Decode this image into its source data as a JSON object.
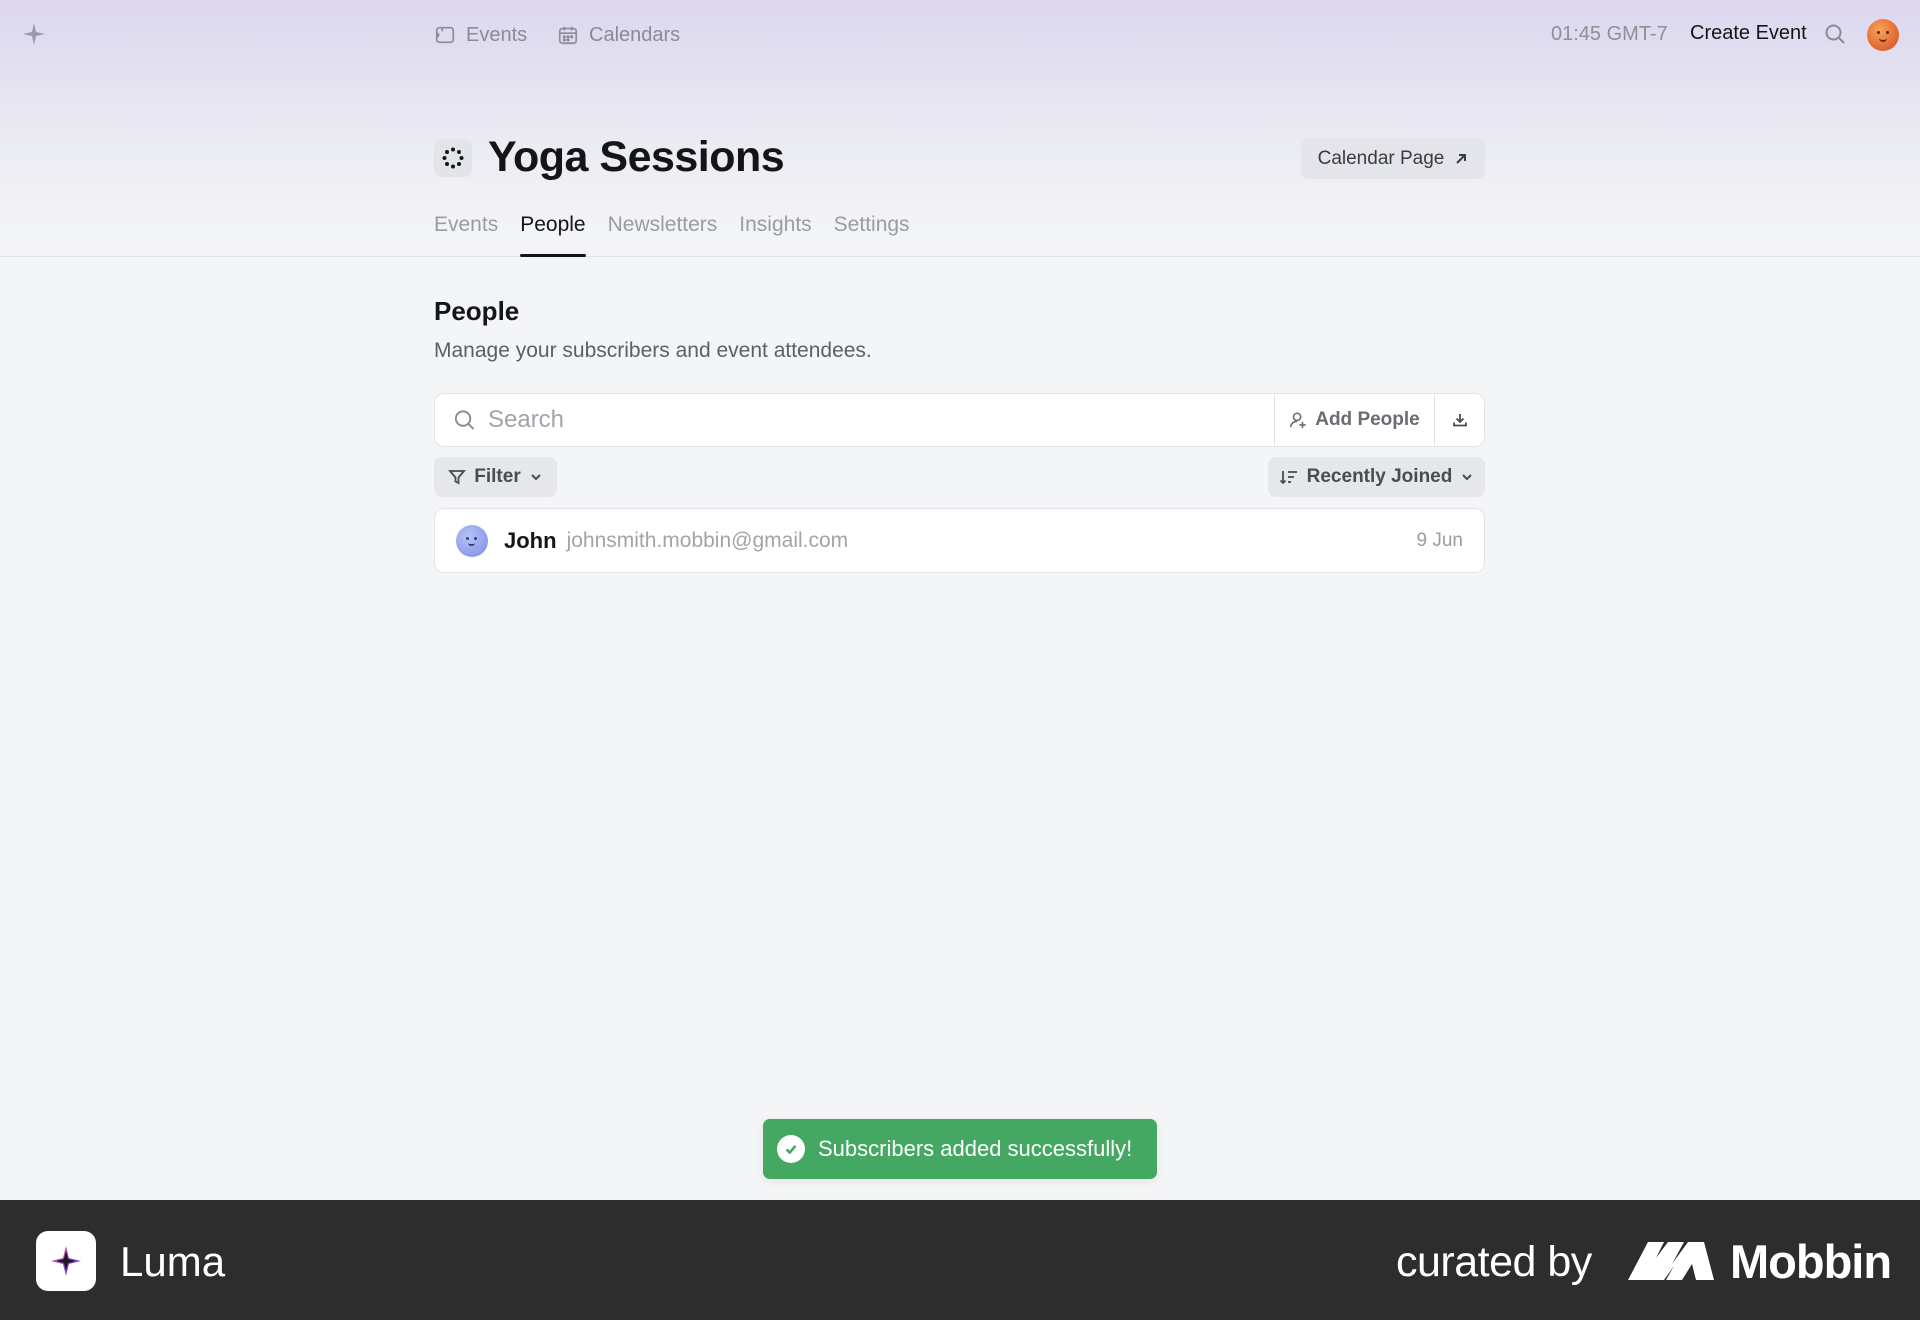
{
  "topnav": {
    "links": [
      {
        "label": "Events",
        "icon": "ticket-icon"
      },
      {
        "label": "Calendars",
        "icon": "calendar-icon"
      }
    ],
    "time": "01:45 GMT-7",
    "create_event": "Create Event"
  },
  "header": {
    "title": "Yoga Sessions",
    "calendar_page_button": "Calendar Page",
    "tabs": [
      {
        "label": "Events",
        "active": false
      },
      {
        "label": "People",
        "active": true
      },
      {
        "label": "Newsletters",
        "active": false
      },
      {
        "label": "Insights",
        "active": false
      },
      {
        "label": "Settings",
        "active": false
      }
    ]
  },
  "people": {
    "title": "People",
    "subtitle": "Manage your subscribers and event attendees.",
    "search_placeholder": "Search",
    "add_people": "Add People",
    "filter": "Filter",
    "sort": "Recently Joined",
    "rows": [
      {
        "name": "John",
        "email": "johnsmith.mobbin@gmail.com",
        "date": "9 Jun"
      }
    ]
  },
  "toast": {
    "message": "Subscribers added successfully!",
    "color": "#45a862"
  },
  "footer": {
    "app_name": "Luma",
    "curated_by": "curated by",
    "brand": "Mobbin"
  },
  "colors": {
    "accent_text": "#131517",
    "footer_bg": "#2d2d2e"
  }
}
